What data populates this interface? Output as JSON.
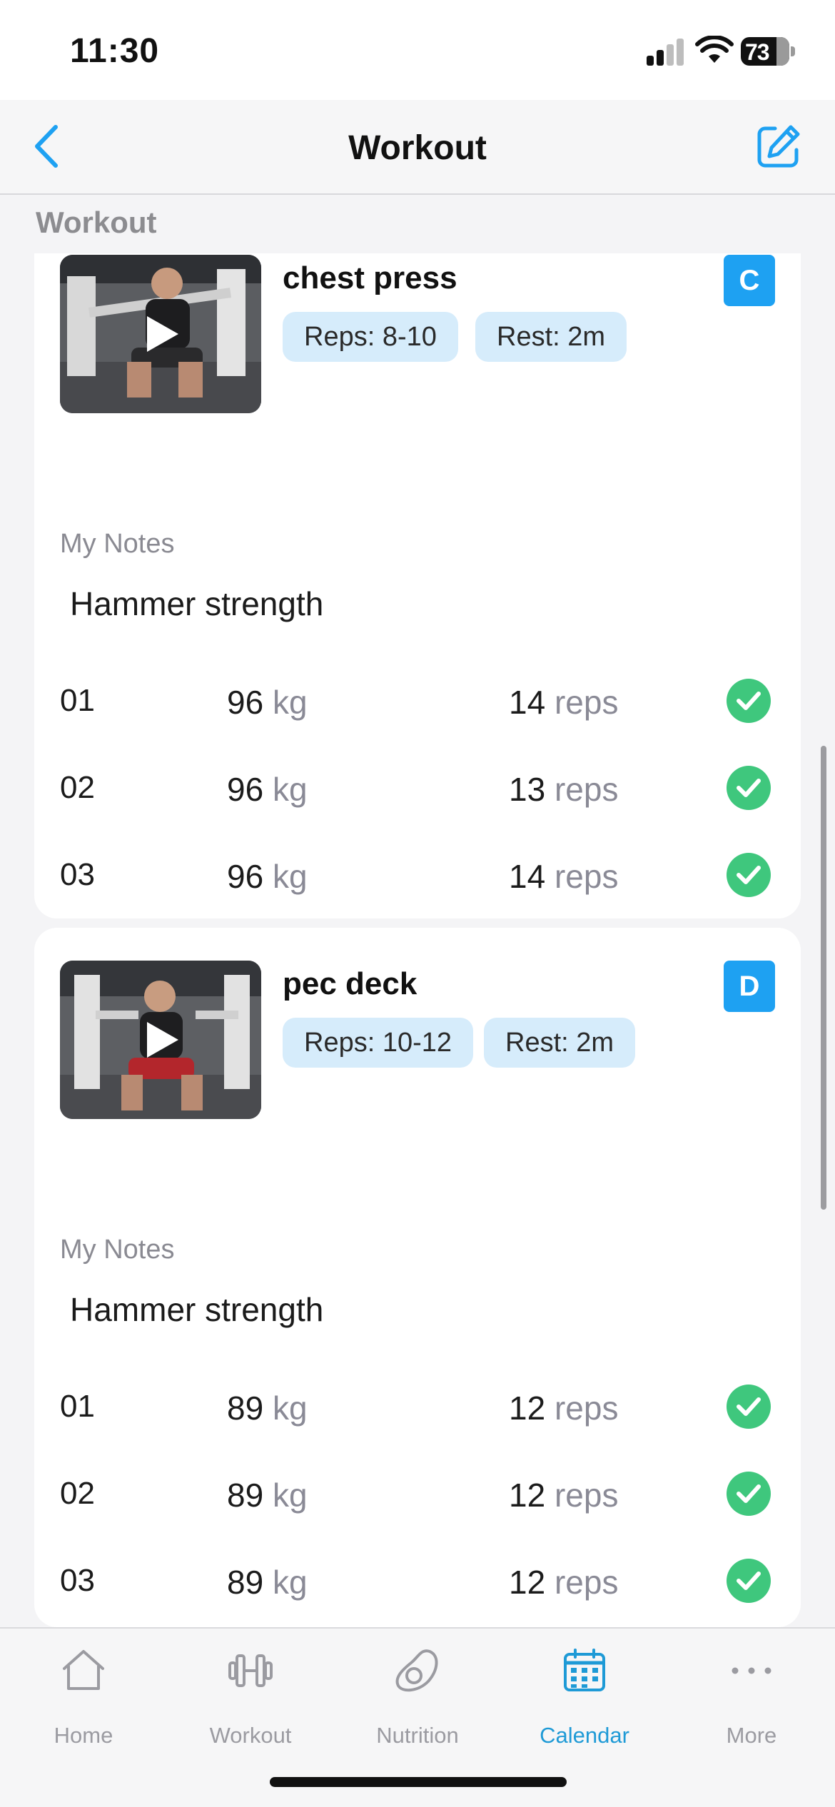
{
  "status_bar": {
    "time": "11:30",
    "battery": "73"
  },
  "nav": {
    "title": "Workout",
    "back_icon": "chevron-left-icon",
    "edit_icon": "edit-icon"
  },
  "section_title": "Workout",
  "accent_color": "#1ea1f2",
  "check_color": "#3fc77d",
  "exercises": [
    {
      "name": "chest press",
      "letter": "C",
      "reps_tag": "Reps: 8-10",
      "rest_tag": "Rest: 2m",
      "notes_label": "My Notes",
      "notes": "Hammer strength",
      "sets": [
        {
          "num": "01",
          "weight": "96",
          "weight_unit": "kg",
          "reps": "14",
          "reps_unit": "reps",
          "done": true
        },
        {
          "num": "02",
          "weight": "96",
          "weight_unit": "kg",
          "reps": "13",
          "reps_unit": "reps",
          "done": true
        },
        {
          "num": "03",
          "weight": "96",
          "weight_unit": "kg",
          "reps": "14",
          "reps_unit": "reps",
          "done": true
        }
      ]
    },
    {
      "name": "pec deck",
      "letter": "D",
      "reps_tag": "Reps: 10-12",
      "rest_tag": "Rest: 2m",
      "notes_label": "My Notes",
      "notes": "Hammer strength",
      "sets": [
        {
          "num": "01",
          "weight": "89",
          "weight_unit": "kg",
          "reps": "12",
          "reps_unit": "reps",
          "done": true
        },
        {
          "num": "02",
          "weight": "89",
          "weight_unit": "kg",
          "reps": "12",
          "reps_unit": "reps",
          "done": true
        },
        {
          "num": "03",
          "weight": "89",
          "weight_unit": "kg",
          "reps": "12",
          "reps_unit": "reps",
          "done": true
        }
      ]
    }
  ],
  "tabs": [
    {
      "label": "Home",
      "icon": "home-icon",
      "active": false
    },
    {
      "label": "Workout",
      "icon": "dumbbell-icon",
      "active": false
    },
    {
      "label": "Nutrition",
      "icon": "avocado-icon",
      "active": false
    },
    {
      "label": "Calendar",
      "icon": "calendar-icon",
      "active": true
    },
    {
      "label": "More",
      "icon": "more-icon",
      "active": false
    }
  ]
}
